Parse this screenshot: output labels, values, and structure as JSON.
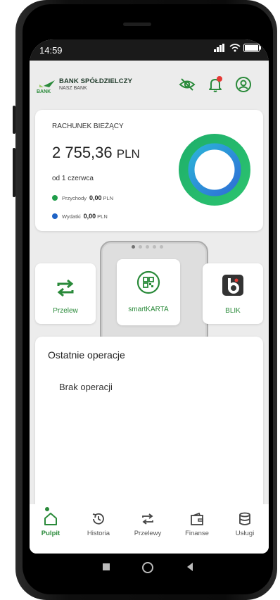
{
  "status": {
    "time": "14:59"
  },
  "header": {
    "brand_line1": "BANK SPÓŁDZIELCZY",
    "brand_line2": "NASZ BANK",
    "logo_text": "BANK",
    "icons": [
      "eye-off-icon",
      "bell-icon",
      "user-icon"
    ],
    "notification_color": "#e53935"
  },
  "account": {
    "title": "RACHUNEK BIEŻĄCY",
    "balance": "2 755,36",
    "currency": "PLN",
    "since": "od 1 czerwca",
    "income_label": "Przychody",
    "income_value": "0,00",
    "income_currency": "PLN",
    "expense_label": "Wydatki",
    "expense_value": "0,00",
    "expense_currency": "PLN",
    "income_color": "#1f9d4a",
    "expense_color": "#1e63c6"
  },
  "pager": {
    "count": 5,
    "active": 0
  },
  "tiles": [
    {
      "label": "Przelew",
      "icon": "transfer-icon"
    },
    {
      "label": "smartKARTA",
      "icon": "qr-code-icon"
    },
    {
      "label": "BLIK",
      "icon": "blik-icon"
    }
  ],
  "operations": {
    "title": "Ostatnie operacje",
    "empty_text": "Brak operacji"
  },
  "nav": [
    {
      "label": "Pulpit",
      "icon": "home-icon",
      "active": true
    },
    {
      "label": "Historia",
      "icon": "history-icon",
      "active": false
    },
    {
      "label": "Przelewy",
      "icon": "transfers-icon",
      "active": false
    },
    {
      "label": "Finanse",
      "icon": "wallet-icon",
      "active": false
    },
    {
      "label": "Usługi",
      "icon": "database-icon",
      "active": false
    }
  ],
  "colors": {
    "accent": "#2a8a3a",
    "background": "#ececec"
  }
}
